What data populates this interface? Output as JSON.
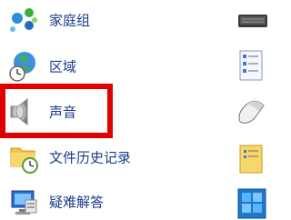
{
  "items": [
    {
      "label": "家庭组",
      "icon": "homegroup-icon"
    },
    {
      "label": "区域",
      "icon": "region-globe-clock-icon"
    },
    {
      "label": "声音",
      "icon": "sound-speaker-icon"
    },
    {
      "label": "文件历史记录",
      "icon": "file-history-folder-clock-icon"
    },
    {
      "label": "疑难解答",
      "icon": "troubleshooting-monitor-icon"
    }
  ],
  "right_icons": [
    "keyboard-icon",
    "checklist-document-icon",
    "mouse-icon",
    "folder-checklist-icon",
    "windows-intel-icon"
  ],
  "highlight": {
    "target": "声音",
    "color": "#e00000"
  },
  "colors": {
    "label": "#1a3a8a",
    "background": "#ffffff"
  }
}
